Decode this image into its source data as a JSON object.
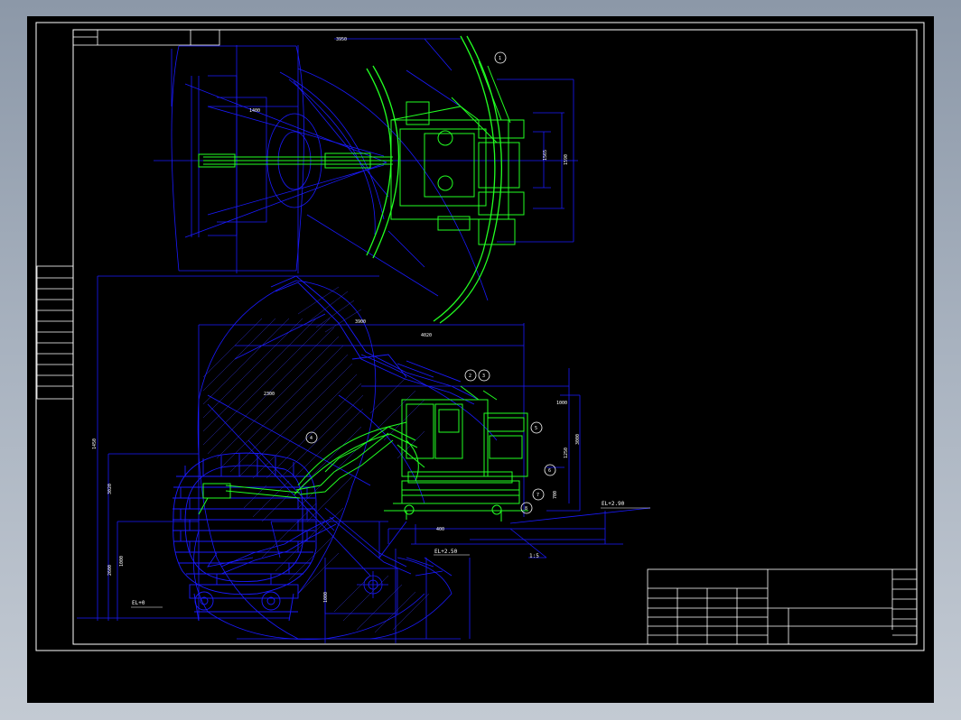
{
  "drawing": {
    "colors": {
      "background": "#000000",
      "frame": "#ffffff",
      "outline": "#1a1aff",
      "machine": "#22ff22",
      "hatch": "#3030d0"
    },
    "dimensions": {
      "plan_top": "3950",
      "plan_inner": "1400",
      "plan_side_1": "1565",
      "plan_side_2": "1590",
      "elev_top_1": "3900",
      "elev_top_2": "4020",
      "elev_mid": "2300",
      "elev_left_1": "1450",
      "elev_left_2": "3020",
      "elev_left_3": "1000",
      "elev_bottom_1": "2600",
      "elev_bottom_2": "1000",
      "elev_right_1": "1000",
      "elev_right_2": "3000",
      "elev_right_3": "1250",
      "elev_right_4": "700",
      "ground_base": "400"
    },
    "annotations": {
      "level_right": "EL+2.90",
      "level_mid": "EL+2.50",
      "level_left": "EL+0",
      "pointer_label": "1:5"
    },
    "balloons": [
      "1",
      "2",
      "3",
      "4",
      "5",
      "6",
      "7",
      "8"
    ]
  }
}
